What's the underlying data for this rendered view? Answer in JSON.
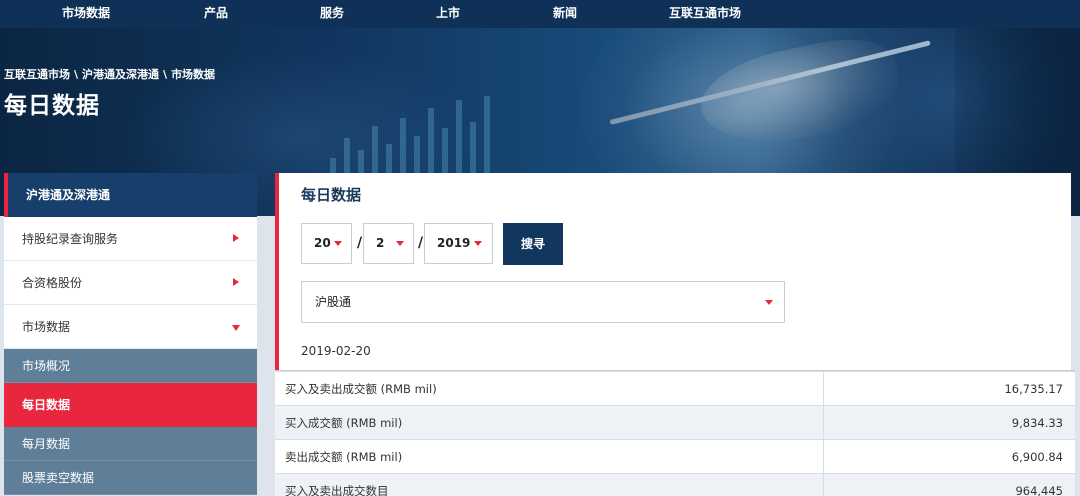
{
  "top_nav": [
    {
      "label": "市场数据"
    },
    {
      "label": "产品"
    },
    {
      "label": "服务"
    },
    {
      "label": "上市"
    },
    {
      "label": "新闻"
    },
    {
      "label": "互联互通市场"
    }
  ],
  "breadcrumb": {
    "items": [
      "互联互通市场",
      "沪港通及深港通",
      "市场数据"
    ],
    "separator": "\\"
  },
  "page_title": "每日数据",
  "sidebar": {
    "header": "沪港通及深港通",
    "items": [
      {
        "label": "持股纪录查询服务",
        "icon": "chevron-right-icon"
      },
      {
        "label": "合资格股份",
        "icon": "chevron-right-icon"
      },
      {
        "label": "市场数据",
        "icon": "chevron-down-icon"
      }
    ],
    "sub_items": [
      {
        "label": "市场概况"
      },
      {
        "label": "每日数据",
        "active": true
      },
      {
        "label": "每月数据"
      },
      {
        "label": "股票卖空数据"
      }
    ]
  },
  "main": {
    "title": "每日数据",
    "day": "20",
    "month": "2",
    "year": "2019",
    "slash": "/",
    "search_label": "搜寻",
    "market": "沪股通",
    "date": "2019-02-20",
    "rows": [
      {
        "label": "买入及卖出成交额 (RMB mil)",
        "value": "16,735.17"
      },
      {
        "label": "买入成交额 (RMB mil)",
        "value": "9,834.33"
      },
      {
        "label": "卖出成交额 (RMB mil)",
        "value": "6,900.84"
      },
      {
        "label": "买入及卖出成交数目",
        "value": "964,445"
      }
    ]
  },
  "colors": {
    "nav_bg": "#0f3158",
    "accent_red": "#e8273e",
    "sub_item_bg": "#5f7f99",
    "button_bg": "#12375f"
  }
}
